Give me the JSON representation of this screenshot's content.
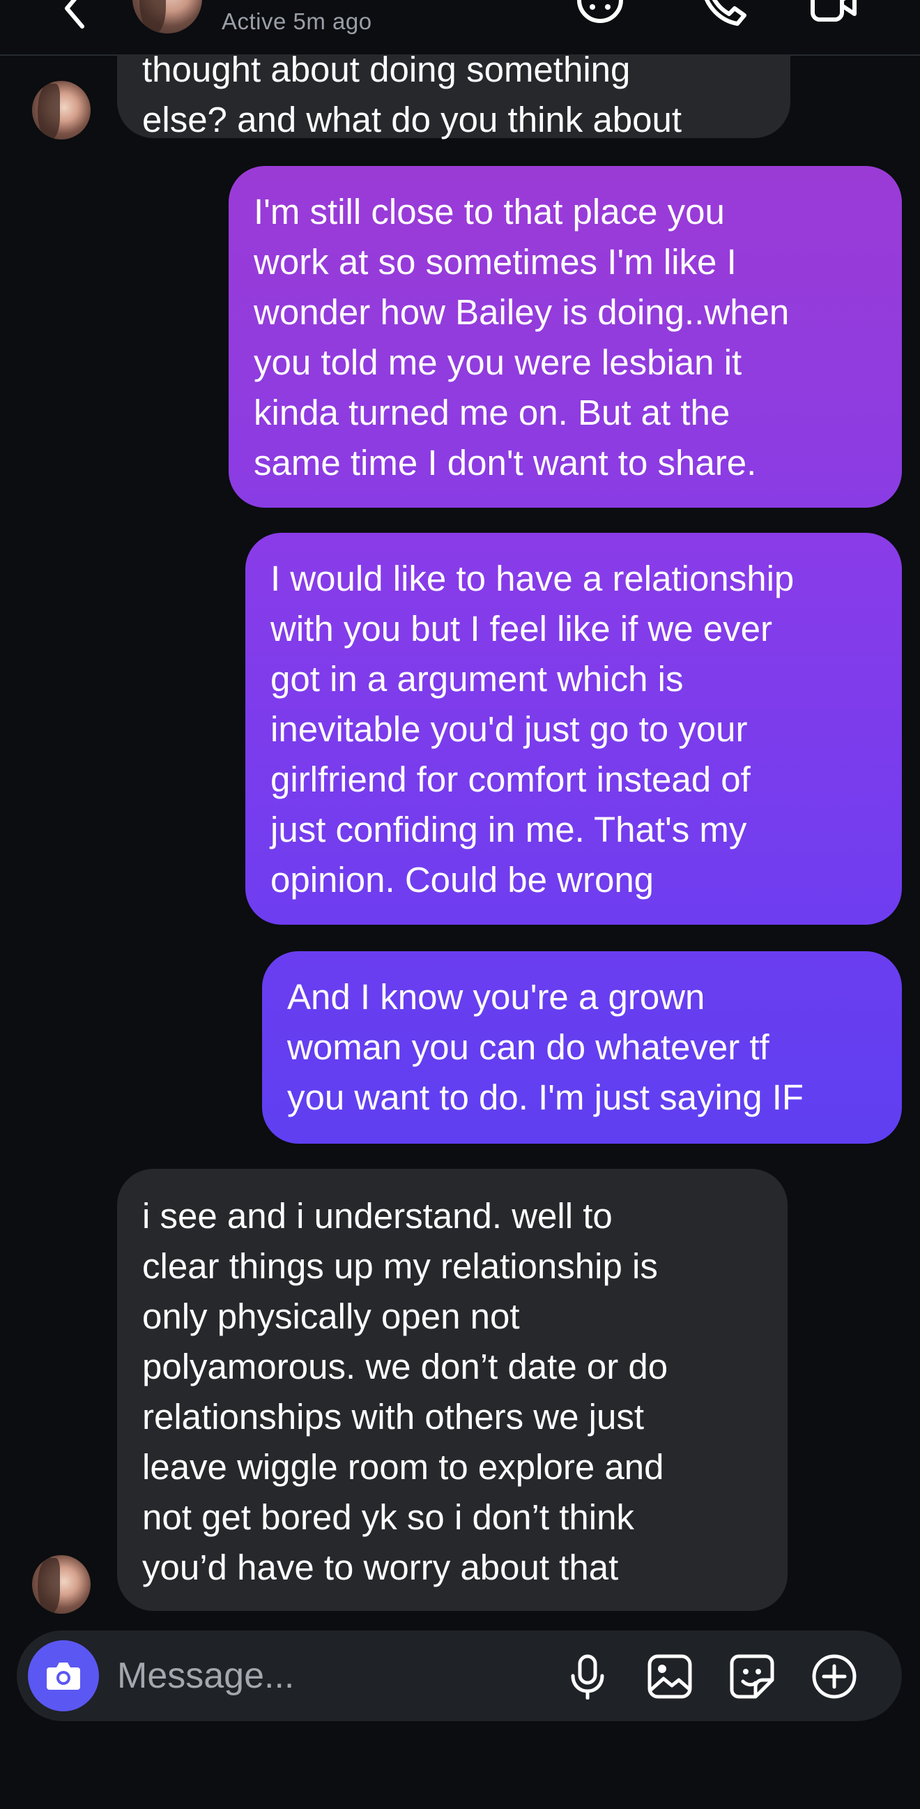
{
  "header": {
    "status": "Active 5m ago"
  },
  "messages": [
    {
      "direction": "received",
      "text": "thought about doing something\nelse? and what do you think about"
    },
    {
      "direction": "sent",
      "text": "I'm still close to that place you\nwork at so sometimes I'm like I\nwonder how Bailey is doing..when\nyou told me you were lesbian it\nkinda turned me on. But at the\nsame time I don't want to share."
    },
    {
      "direction": "sent",
      "text": "I would like to have a relationship\nwith you but I feel like if we ever\ngot in a argument which is\ninevitable you'd just go to your\ngirlfriend for comfort instead of\njust   confiding in me. That's my\nopinion. Could be wrong"
    },
    {
      "direction": "sent",
      "text": "And I know you're a grown\nwoman you can do whatever tf\nyou want to do. I'm just saying IF"
    },
    {
      "direction": "received",
      "text": "i see and i understand. well to\nclear things up my relationship is\nonly physically open not\npolyamorous. we don’t date or do\nrelationships with others we just\nleave wiggle room to explore and\nnot get bored yk so i don’t think\nyou’d have to worry about that"
    }
  ],
  "composer": {
    "placeholder": "Message..."
  },
  "colors": {
    "background": "#0b0d10",
    "received_bubble": "#26282c",
    "sent_gradient_top": "#9b3bd6",
    "sent_gradient_mid": "#7a3df0",
    "sent_gradient_bottom": "#5f3ff1",
    "camera_button": "#5b57f2"
  },
  "icons": {
    "header": [
      "back-chevron-icon",
      "sticker-face-icon",
      "phone-icon",
      "video-camera-icon"
    ],
    "composer": [
      "camera-icon",
      "microphone-icon",
      "gallery-icon",
      "sticker-icon",
      "plus-circle-icon"
    ]
  }
}
